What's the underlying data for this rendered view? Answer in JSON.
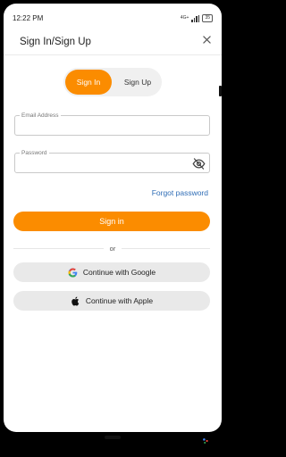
{
  "status_bar": {
    "time": "12:22 PM",
    "network": "4G+",
    "battery": "35"
  },
  "header": {
    "title": "Sign In/Sign Up",
    "close_icon": "close-icon"
  },
  "tabs": [
    {
      "label": "Sign In",
      "active": true
    },
    {
      "label": "Sign Up",
      "active": false
    }
  ],
  "form": {
    "email": {
      "label": "Email Address",
      "value": ""
    },
    "password": {
      "label": "Password",
      "value": "",
      "toggle_icon": "eye-off-icon"
    },
    "forgot_password": "Forgot password",
    "submit_label": "Sign in",
    "divider_text": "or"
  },
  "social": {
    "google_label": "Continue with Google",
    "apple_label": "Continue with Apple"
  },
  "colors": {
    "accent": "#fb8c00",
    "link": "#2f6db6",
    "social_bg": "#e9e9e9"
  }
}
